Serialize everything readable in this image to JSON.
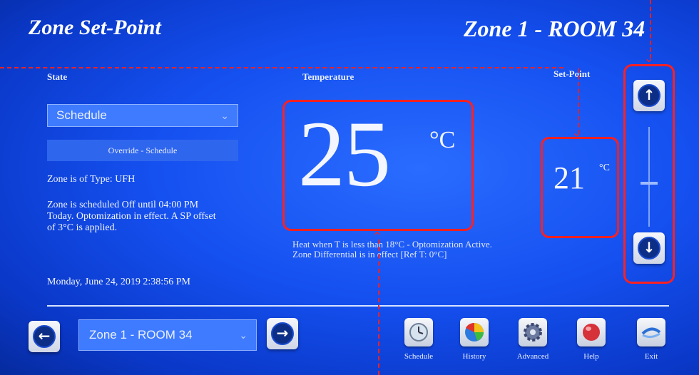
{
  "header": {
    "title": "Zone Set-Point",
    "zone_title": "Zone 1 - ROOM 34"
  },
  "state": {
    "label": "State",
    "mode_value": "Schedule",
    "override_label": "Override - Schedule",
    "zone_type": "Zone is of Type: UFH",
    "schedule_info": [
      "Zone is scheduled Off until 04:00 PM",
      "Today. Optomization in effect. A SP offset",
      "of 3°C is applied."
    ],
    "datetime": "Monday, June 24, 2019 2:38:56 PM"
  },
  "temperature": {
    "label": "Temperature",
    "value": "25",
    "unit": "°C",
    "messages": [
      "Heat when T is less than  18°C - Optomization Active.",
      "Zone Differential is in effect [Ref T: 0°C]"
    ]
  },
  "setpoint": {
    "label": "Set-Point",
    "value": "21",
    "unit": "°C",
    "slider_level_fraction": 0.45
  },
  "footer": {
    "zone_selector_value": "Zone 1 - ROOM 34",
    "tools": [
      {
        "label": "Schedule",
        "icon": "clock-icon"
      },
      {
        "label": "History",
        "icon": "pie-chart-icon"
      },
      {
        "label": "Advanced",
        "icon": "gear-icon"
      },
      {
        "label": "Help",
        "icon": "help-icon"
      },
      {
        "label": "Exit",
        "icon": "exit-icon"
      }
    ]
  },
  "colors": {
    "background": "#1550f0",
    "highlight": "#ff2020"
  }
}
